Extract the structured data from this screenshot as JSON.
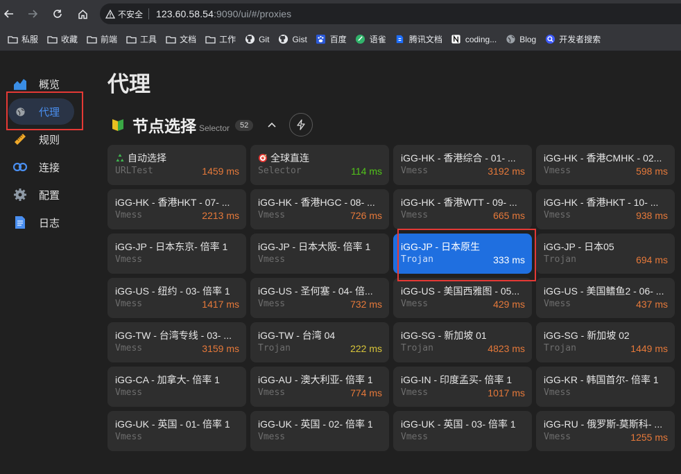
{
  "browser": {
    "security_label": "不安全",
    "url_host": "123.60.58.54",
    "url_rest": ":9090/ui/#/proxies",
    "bookmarks": [
      {
        "label": "私服",
        "icon": "folder-icon"
      },
      {
        "label": "收藏",
        "icon": "folder-icon"
      },
      {
        "label": "前端",
        "icon": "folder-icon"
      },
      {
        "label": "工具",
        "icon": "folder-icon"
      },
      {
        "label": "文档",
        "icon": "folder-icon"
      },
      {
        "label": "工作",
        "icon": "folder-icon"
      },
      {
        "label": "Git",
        "icon": "github-icon"
      },
      {
        "label": "Gist",
        "icon": "github-icon"
      },
      {
        "label": "百度",
        "icon": "baidu-icon"
      },
      {
        "label": "语雀",
        "icon": "yuque-icon"
      },
      {
        "label": "腾讯文档",
        "icon": "tencent-docs-icon"
      },
      {
        "label": "coding...",
        "icon": "notion-icon"
      },
      {
        "label": "Blog",
        "icon": "globe-icon"
      },
      {
        "label": "开发者搜索",
        "icon": "search-icon"
      }
    ]
  },
  "sidebar": {
    "items": [
      {
        "label": "概览",
        "icon": "chart-area-icon"
      },
      {
        "label": "代理",
        "icon": "globe-icon"
      },
      {
        "label": "规则",
        "icon": "ruler-icon"
      },
      {
        "label": "连接",
        "icon": "link-icon"
      },
      {
        "label": "配置",
        "icon": "gear-icon"
      },
      {
        "label": "日志",
        "icon": "document-icon"
      }
    ],
    "active_index": 1
  },
  "page": {
    "title": "代理",
    "group": {
      "name": "节点选择",
      "type": "Selector",
      "count": "52"
    }
  },
  "colors": {
    "accent": "#1f6fe0",
    "delay_slow": "#e6793a",
    "delay_fast": "#52c41a",
    "delay_medium": "#d9c63a"
  },
  "proxies": [
    {
      "name": "自动选择",
      "type": "URLTest",
      "delay": "1459 ms",
      "level": "orange",
      "emoji": "recycle-icon"
    },
    {
      "name": "全球直连",
      "type": "Selector",
      "delay": "114 ms",
      "level": "green",
      "emoji": "target-icon"
    },
    {
      "name": "iGG-HK - 香港综合 - 01- ...",
      "type": "Vmess",
      "delay": "3192 ms",
      "level": "orange"
    },
    {
      "name": "iGG-HK - 香港CMHK - 02...",
      "type": "Vmess",
      "delay": "598 ms",
      "level": "orange"
    },
    {
      "name": "iGG-HK - 香港HKT - 07- ...",
      "type": "Vmess",
      "delay": "2213 ms",
      "level": "orange"
    },
    {
      "name": "iGG-HK - 香港HGC - 08- ...",
      "type": "Vmess",
      "delay": "726 ms",
      "level": "orange"
    },
    {
      "name": "iGG-HK - 香港WTT - 09- ...",
      "type": "Vmess",
      "delay": "665 ms",
      "level": "orange"
    },
    {
      "name": "iGG-HK - 香港HKT - 10- ...",
      "type": "Vmess",
      "delay": "938 ms",
      "level": "orange"
    },
    {
      "name": "iGG-JP - 日本东京- 倍率 1",
      "type": "Vmess",
      "delay": "",
      "level": "orange"
    },
    {
      "name": "iGG-JP - 日本大阪- 倍率 1",
      "type": "Vmess",
      "delay": "",
      "level": "orange"
    },
    {
      "name": "iGG-JP - 日本原生",
      "type": "Trojan",
      "delay": "333 ms",
      "level": "selected"
    },
    {
      "name": "iGG-JP - 日本05",
      "type": "Trojan",
      "delay": "694 ms",
      "level": "orange"
    },
    {
      "name": "iGG-US - 纽约 - 03- 倍率 1",
      "type": "Vmess",
      "delay": "1417 ms",
      "level": "orange"
    },
    {
      "name": "iGG-US - 圣何塞 - 04- 倍...",
      "type": "Vmess",
      "delay": "732 ms",
      "level": "orange"
    },
    {
      "name": "iGG-US - 美国西雅图 - 05...",
      "type": "Vmess",
      "delay": "429 ms",
      "level": "orange"
    },
    {
      "name": "iGG-US - 美国鳍鱼2 - 06- ...",
      "type": "Vmess",
      "delay": "437 ms",
      "level": "orange"
    },
    {
      "name": "iGG-TW - 台湾专线 - 03- ...",
      "type": "Vmess",
      "delay": "3159 ms",
      "level": "orange"
    },
    {
      "name": "iGG-TW - 台湾 04",
      "type": "Trojan",
      "delay": "222 ms",
      "level": "yellow"
    },
    {
      "name": "iGG-SG - 新加坡 01",
      "type": "Trojan",
      "delay": "4823 ms",
      "level": "orange"
    },
    {
      "name": "iGG-SG - 新加坡 02",
      "type": "Trojan",
      "delay": "1449 ms",
      "level": "orange"
    },
    {
      "name": "iGG-CA - 加拿大- 倍率 1",
      "type": "Vmess",
      "delay": "",
      "level": "orange"
    },
    {
      "name": "iGG-AU - 澳大利亚- 倍率 1",
      "type": "Vmess",
      "delay": "774 ms",
      "level": "orange"
    },
    {
      "name": "iGG-IN - 印度孟买- 倍率 1",
      "type": "Vmess",
      "delay": "1017 ms",
      "level": "orange"
    },
    {
      "name": "iGG-KR - 韩国首尔- 倍率 1",
      "type": "Vmess",
      "delay": "",
      "level": "orange"
    },
    {
      "name": "iGG-UK - 英国 - 01- 倍率 1",
      "type": "Vmess",
      "delay": "",
      "level": "orange"
    },
    {
      "name": "iGG-UK - 英国 - 02- 倍率 1",
      "type": "Vmess",
      "delay": "",
      "level": "orange"
    },
    {
      "name": "iGG-UK - 英国 - 03- 倍率 1",
      "type": "Vmess",
      "delay": "",
      "level": "orange"
    },
    {
      "name": "iGG-RU - 俄罗斯-莫斯科- ...",
      "type": "Vmess",
      "delay": "1255 ms",
      "level": "orange"
    }
  ]
}
